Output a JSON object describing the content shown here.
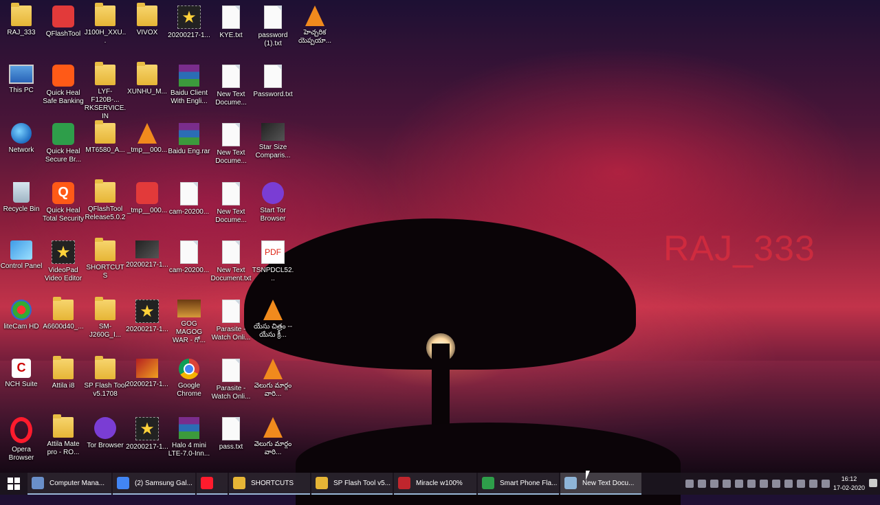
{
  "watermark": "RAJ_333",
  "desktop_icons": [
    {
      "label": "RAJ_333",
      "icon": "user-folder-icon"
    },
    {
      "label": "QFlashTool",
      "icon": "qflash-icon"
    },
    {
      "label": "J100H_XXU...",
      "icon": "folder-icon"
    },
    {
      "label": "VIVOX",
      "icon": "folder-icon"
    },
    {
      "label": "20200217-1...",
      "icon": "video-star-icon"
    },
    {
      "label": "KYE.txt",
      "icon": "text-file-icon"
    },
    {
      "label": "password (1).txt",
      "icon": "text-file-icon"
    },
    {
      "label": "హెచ్చరిక యెప్పయా...",
      "icon": "vlc-icon"
    },
    {
      "label": "This PC",
      "icon": "computer-icon"
    },
    {
      "label": "Quick Heal Safe Banking",
      "icon": "quickheal-banking-icon"
    },
    {
      "label": "LYF-F120B-... RKSERVICE.IN",
      "icon": "folder-icon"
    },
    {
      "label": "XUNHU_M...",
      "icon": "folder-icon"
    },
    {
      "label": "Baidu Client With Engli...",
      "icon": "rar-icon"
    },
    {
      "label": "New Text Docume...",
      "icon": "text-file-icon"
    },
    {
      "label": "Password.txt",
      "icon": "text-file-icon"
    },
    {
      "label": "Network",
      "icon": "network-globe-icon"
    },
    {
      "label": "Quick Heal Secure Br...",
      "icon": "quickheal-browser-icon"
    },
    {
      "label": "MT6580_A...",
      "icon": "folder-icon"
    },
    {
      "label": "_tmp__000...",
      "icon": "vlc-icon"
    },
    {
      "label": "Baidu Eng.rar",
      "icon": "rar-icon"
    },
    {
      "label": "New Text Docume...",
      "icon": "text-file-icon"
    },
    {
      "label": "Star Size Comparis...",
      "icon": "photo-icon"
    },
    {
      "label": "Recycle Bin",
      "icon": "recycle-bin-icon"
    },
    {
      "label": "Quick Heal Total Security",
      "icon": "quickheal-icon"
    },
    {
      "label": "QFlashTool Release5.0.2",
      "icon": "folder-icon"
    },
    {
      "label": "_tmp__000...",
      "icon": "headphones-icon"
    },
    {
      "label": "cam-20200...",
      "icon": "text-file-icon"
    },
    {
      "label": "New Text Docume...",
      "icon": "text-file-icon"
    },
    {
      "label": "Start Tor Browser",
      "icon": "tor-icon"
    },
    {
      "label": "Control Panel",
      "icon": "control-panel-icon"
    },
    {
      "label": "VideoPad Video Editor",
      "icon": "videopad-icon"
    },
    {
      "label": "SHORTCUTS",
      "icon": "folder-icon"
    },
    {
      "label": "20200217-1...",
      "icon": "photo-icon"
    },
    {
      "label": "cam-20200...",
      "icon": "text-file-icon"
    },
    {
      "label": "New Text Document.txt",
      "icon": "text-file-icon"
    },
    {
      "label": "TSNPDCL52...",
      "icon": "pdf-icon"
    },
    {
      "label": "liteCam HD",
      "icon": "litecam-icon"
    },
    {
      "label": "A6600d40_...",
      "icon": "folder-icon"
    },
    {
      "label": "SM-J260G_I...",
      "icon": "folder-icon"
    },
    {
      "label": "20200217-1...",
      "icon": "video-star-icon"
    },
    {
      "label": "GOG MAGOG WAR - గో...",
      "icon": "video-thumbnail-icon"
    },
    {
      "label": "Parasite - Watch Onli...",
      "icon": "browser-page-icon"
    },
    {
      "label": "యేసు చిత్రం -- యేసు క్రీ...",
      "icon": "vlc-icon"
    },
    {
      "label": "NCH Suite",
      "icon": "nch-icon"
    },
    {
      "label": "Attila i8",
      "icon": "folder-icon"
    },
    {
      "label": "SP Flash Tool v5.1708",
      "icon": "folder-icon"
    },
    {
      "label": "20200217-1...",
      "icon": "movie-icon"
    },
    {
      "label": "Google Chrome",
      "icon": "chrome-icon"
    },
    {
      "label": "Parasite - Watch Onli...",
      "icon": "text-file-icon"
    },
    {
      "label": "వెలుగు మార్గం వారి...",
      "icon": "vlc-icon"
    },
    {
      "label": "Opera Browser",
      "icon": "opera-icon"
    },
    {
      "label": "Attila Mate pro - RO...",
      "icon": "folder-icon"
    },
    {
      "label": "Tor Browser",
      "icon": "tor-icon"
    },
    {
      "label": "20200217-1...",
      "icon": "video-star-icon"
    },
    {
      "label": "Halo 4 mini LTE-7.0-Inn...",
      "icon": "rar-icon"
    },
    {
      "label": "pass.txt",
      "icon": "text-file-icon"
    },
    {
      "label": "వెలుగు మార్గం వారి...",
      "icon": "vlc-icon"
    }
  ],
  "taskbar": {
    "start_icon": "windows-start-icon",
    "items": [
      {
        "label": "Computer Mana...",
        "icon": "computer-management-icon",
        "color": "#6a8fc9"
      },
      {
        "label": "(2) Samsung Gal...",
        "icon": "chrome-icon",
        "color": "#4285f4"
      },
      {
        "label": "",
        "icon": "opera-icon",
        "color": "#ff1b2d"
      },
      {
        "label": "SHORTCUTS",
        "icon": "folder-icon",
        "color": "#e6b536"
      },
      {
        "label": "SP Flash Tool v5...",
        "icon": "folder-icon",
        "color": "#e6b536"
      },
      {
        "label": "Miracle w100%",
        "icon": "miracle-icon",
        "color": "#c0262d"
      },
      {
        "label": "Smart Phone Fla...",
        "icon": "spreadsheet-icon",
        "color": "#2e9e4a"
      },
      {
        "label": "New Text Docu...",
        "icon": "notepad-icon",
        "color": "#8fb5d8"
      }
    ],
    "clock_time": "16:12",
    "clock_date": "17-02-2020"
  }
}
